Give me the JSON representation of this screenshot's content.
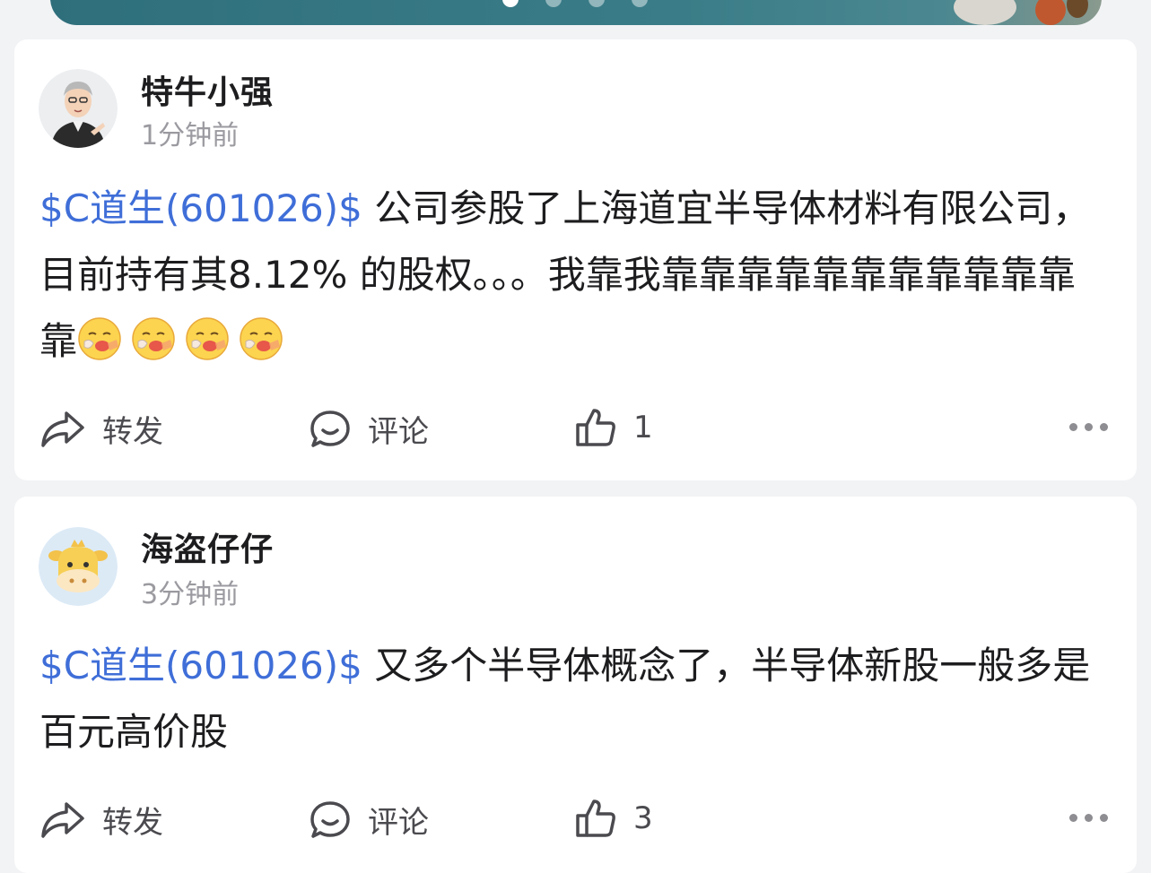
{
  "banner": {
    "active_dot": 0,
    "dot_count": 4
  },
  "posts": [
    {
      "username": "特牛小强",
      "time": "1分钟前",
      "stock_tag": "$C道生(601026)$",
      "text": " 公司参股了上海道宜半导体材料有限公司，目前持有其8.12% 的股权。。。我靠我靠靠靠靠靠靠靠靠靠靠靠靠",
      "emoji_count": 4,
      "emoji_name": "cough-mask-emoji",
      "forward_label": "转发",
      "comment_label": "评论",
      "like_count": "1"
    },
    {
      "username": "海盗仔仔",
      "time": "3分钟前",
      "stock_tag": "$C道生(601026)$",
      "text": " 又多个半导体概念了，半导体新股一般多是百元高价股",
      "forward_label": "转发",
      "comment_label": "评论",
      "like_count": "3"
    }
  ],
  "colors": {
    "stock_link": "#3f6ed8",
    "meta_text": "#9a9aa0",
    "background": "#f2f3f5"
  }
}
